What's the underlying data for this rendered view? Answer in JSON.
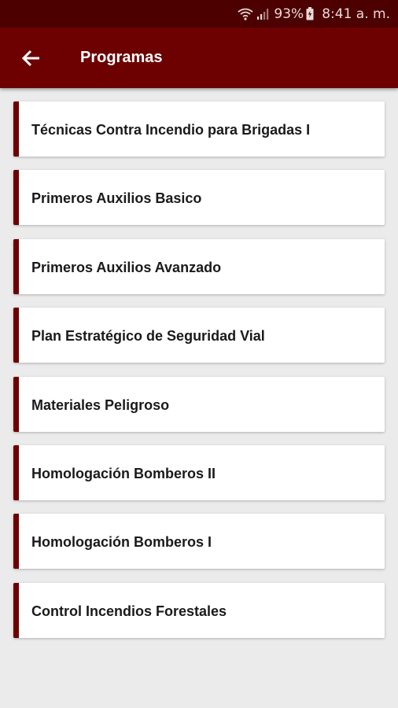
{
  "status_bar": {
    "battery": "93%",
    "time": "8:41 a. m.",
    "icons": [
      "wifi-icon",
      "signal-icon",
      "battery-icon"
    ]
  },
  "app_bar": {
    "title": "Programas",
    "back_icon": "arrow-back-icon"
  },
  "programs": [
    {
      "label": "Técnicas Contra Incendio para Brigadas I"
    },
    {
      "label": "Primeros Auxilios Basico"
    },
    {
      "label": "Primeros Auxilios Avanzado"
    },
    {
      "label": "Plan Estratégico de Seguridad Vial"
    },
    {
      "label": "Materiales Peligroso"
    },
    {
      "label": "Homologación Bomberos II"
    },
    {
      "label": "Homologación Bomberos I"
    },
    {
      "label": "Control Incendios Forestales"
    }
  ],
  "colors": {
    "status_bar": "#4d0000",
    "app_bar": "#6d0000",
    "accent": "#6d0000",
    "background": "#ebebeb"
  }
}
